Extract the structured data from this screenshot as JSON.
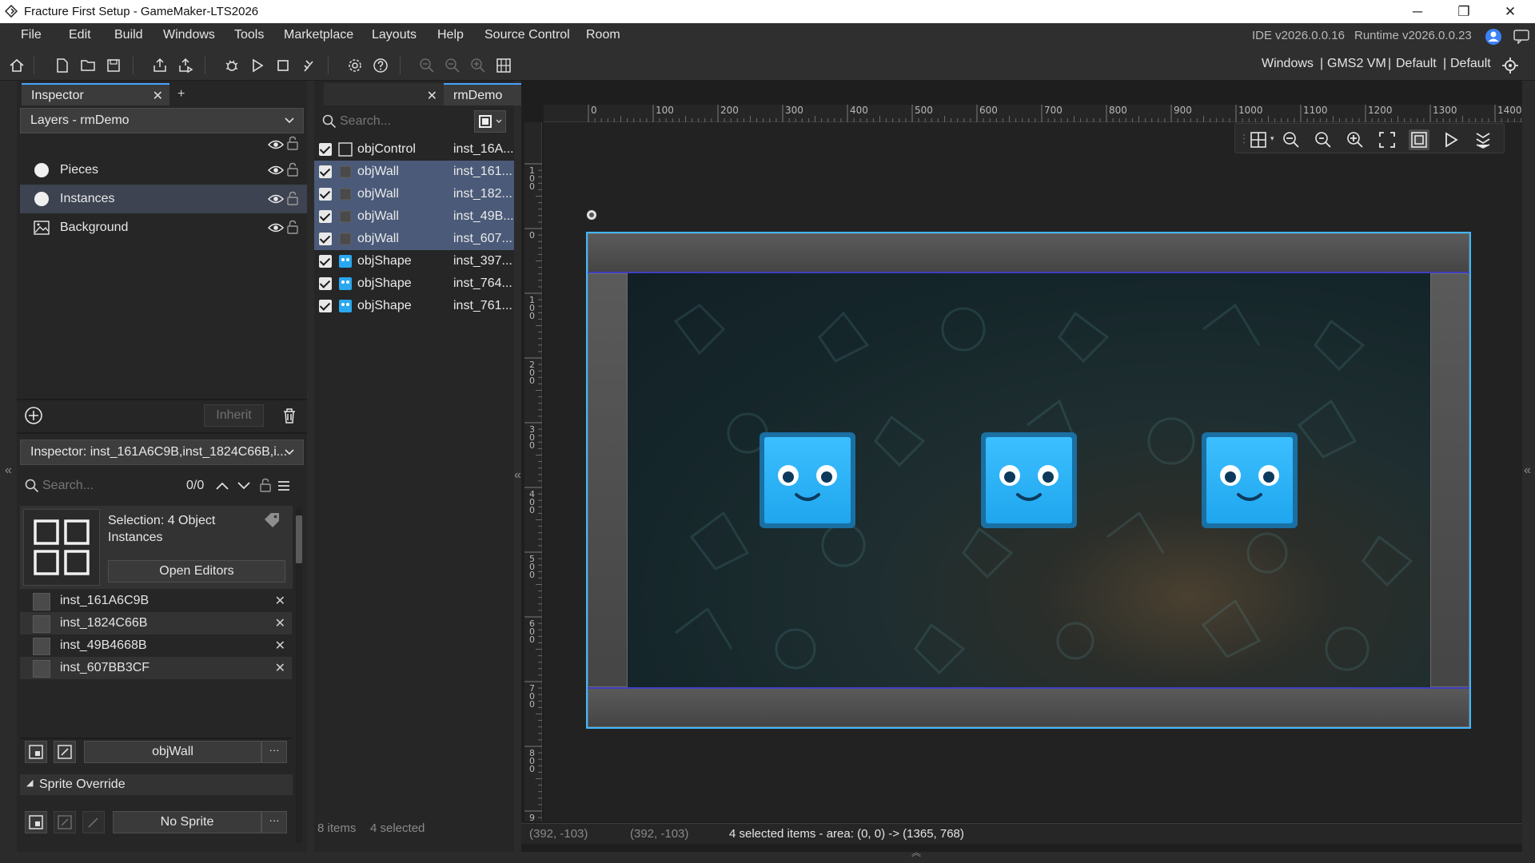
{
  "window": {
    "title": "Fracture First Setup - GameMaker-LTS2026",
    "minimize": "─",
    "restore": "❐",
    "close": "✕"
  },
  "menu": {
    "items": [
      "File",
      "Edit",
      "Build",
      "Windows",
      "Tools",
      "Marketplace",
      "Layouts",
      "Help",
      "Source Control",
      "Room"
    ],
    "ide_version": "IDE v2026.0.0.16",
    "runtime_version": "Runtime v2026.0.0.23"
  },
  "toolbar": {
    "target_platform": "Windows",
    "separator": "|",
    "target_vm": "GMS2 VM",
    "target_config1": "Default",
    "target_config2": "Default"
  },
  "inspector_panel": {
    "tab_label": "Inspector",
    "tab_close": "✕",
    "add_tab": "+",
    "layers_dropdown": "Layers - rmDemo",
    "layers": [
      {
        "name": "Pieces",
        "icon": "instance-layer-icon",
        "selected": false
      },
      {
        "name": "Instances",
        "icon": "instance-layer-icon",
        "selected": true
      },
      {
        "name": "Background",
        "icon": "background-layer-icon",
        "selected": false
      }
    ],
    "inherit_label": "Inherit",
    "inspector_dropdown": "Inspector: inst_161A6C9B,inst_1824C66B,i...",
    "search_placeholder": "Search...",
    "search_count": "0/0",
    "selection_label": "Selection: 4 Object Instances",
    "open_editors_label": "Open Editors",
    "instances": [
      "inst_161A6C9B",
      "inst_1824C66B",
      "inst_49B4668B",
      "inst_607BB3CF"
    ],
    "object_name": "objWall",
    "ellipsis": "···",
    "sprite_override_label": "Sprite Override",
    "no_sprite_label": "No Sprite"
  },
  "resource_panel": {
    "search_placeholder": "Search...",
    "rows": [
      {
        "object": "objControl",
        "instance": "inst_16A...",
        "selected": false,
        "icon": "empty-sprite-icon"
      },
      {
        "object": "objWall",
        "instance": "inst_161...",
        "selected": true,
        "icon": "wall-sprite-icon"
      },
      {
        "object": "objWall",
        "instance": "inst_182...",
        "selected": true,
        "icon": "wall-sprite-icon"
      },
      {
        "object": "objWall",
        "instance": "inst_49B...",
        "selected": true,
        "icon": "wall-sprite-icon"
      },
      {
        "object": "objWall",
        "instance": "inst_607...",
        "selected": true,
        "icon": "wall-sprite-icon"
      },
      {
        "object": "objShape",
        "instance": "inst_397...",
        "selected": false,
        "icon": "shape-sprite-icon"
      },
      {
        "object": "objShape",
        "instance": "inst_764...",
        "selected": false,
        "icon": "shape-sprite-icon"
      },
      {
        "object": "objShape",
        "instance": "inst_761...",
        "selected": false,
        "icon": "shape-sprite-icon"
      }
    ],
    "items_count": "8 items",
    "selected_count": "4 selected"
  },
  "room_editor": {
    "tab_label": "rmDemo",
    "tab_close": "✕",
    "add_tab": "+",
    "ruler_top": [
      "0",
      "100",
      "200",
      "300",
      "400",
      "500",
      "600",
      "700",
      "800",
      "900",
      "1000",
      "1100",
      "1200",
      "1300",
      "1400"
    ],
    "ruler_left": [
      "100",
      "0",
      "100",
      "200",
      "300",
      "400",
      "500",
      "600",
      "700",
      "800",
      "9"
    ],
    "status_cursor1": "(392, -103)",
    "status_cursor2": "(392, -103)",
    "status_selection": "4 selected items - area: (0, 0) -> (1365, 768)",
    "accent_color": "#3fb6ff",
    "face_color": "#28b0f5"
  }
}
